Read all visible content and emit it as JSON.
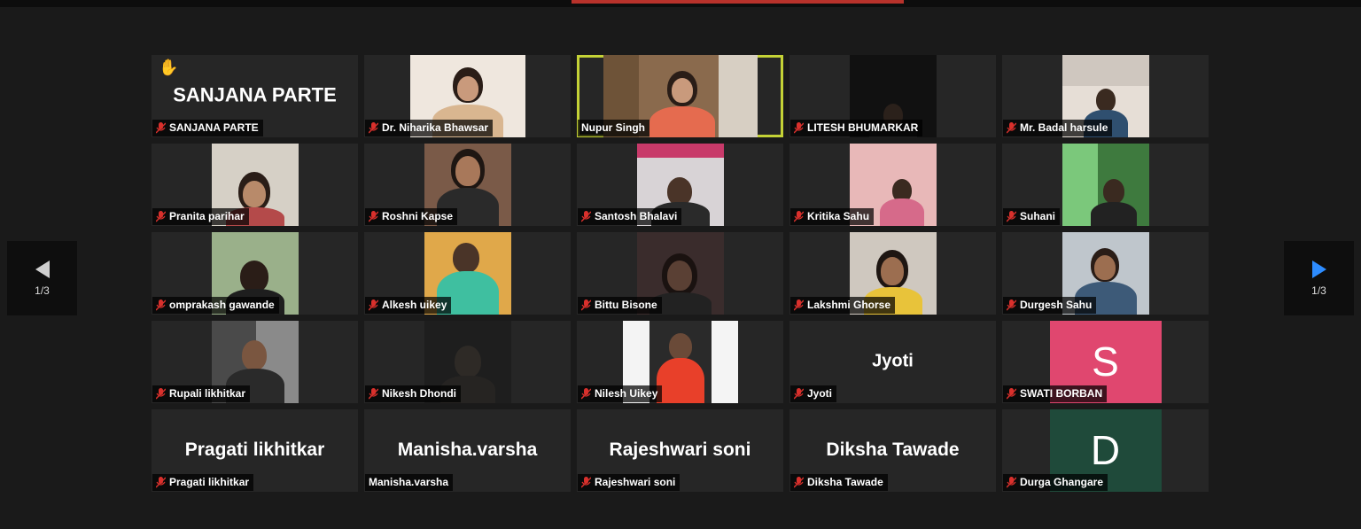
{
  "colors": {
    "active_speaker": "#c4d236",
    "muted_mic": "#d9302c",
    "raised_hand": "#f5b800",
    "tile_bg": "#262626"
  },
  "navigation": {
    "prev_page": "1/3",
    "next_page": "1/3"
  },
  "participants": [
    {
      "name": "SANJANA PARTE",
      "display": "SANJANA PARTE",
      "muted": true,
      "raised_hand": true
    },
    {
      "name": "Dr. Niharika Bhawsar",
      "muted": true
    },
    {
      "name": "Nupur Singh",
      "muted": false,
      "active_speaker": true
    },
    {
      "name": "LITESH BHUMARKAR",
      "muted": true
    },
    {
      "name": "Mr. Badal harsule",
      "muted": true
    },
    {
      "name": "Pranita parihar",
      "muted": true
    },
    {
      "name": "Roshni Kapse",
      "muted": true
    },
    {
      "name": "Santosh Bhalavi",
      "muted": true
    },
    {
      "name": "Kritika Sahu",
      "muted": true
    },
    {
      "name": "Suhani",
      "muted": true
    },
    {
      "name": "omprakash gawande",
      "muted": true
    },
    {
      "name": "Alkesh uikey",
      "muted": true
    },
    {
      "name": "Bittu Bisone",
      "muted": true
    },
    {
      "name": "Lakshmi Ghorse",
      "muted": true
    },
    {
      "name": "Durgesh Sahu",
      "muted": true
    },
    {
      "name": "Rupali likhitkar",
      "muted": true
    },
    {
      "name": "Nikesh Dhondi",
      "muted": true
    },
    {
      "name": "Nilesh Uikey",
      "muted": true
    },
    {
      "name": "Jyoti",
      "display": "Jyoti",
      "muted": true
    },
    {
      "name": "SWATI BORBAN",
      "avatar_letter": "S",
      "avatar_color": "#e0476f",
      "muted": true
    },
    {
      "name": "Pragati likhitkar",
      "display": "Pragati likhitkar",
      "muted": true
    },
    {
      "name": "Manisha.varsha",
      "display": "Manisha.varsha",
      "muted": false
    },
    {
      "name": "Rajeshwari soni",
      "display": "Rajeshwari soni",
      "muted": true
    },
    {
      "name": "Diksha Tawade",
      "display": "Diksha Tawade",
      "muted": true
    },
    {
      "name": "Durga Ghangare",
      "avatar_letter": "D",
      "avatar_color": "#1f4a3a",
      "muted": true
    }
  ]
}
